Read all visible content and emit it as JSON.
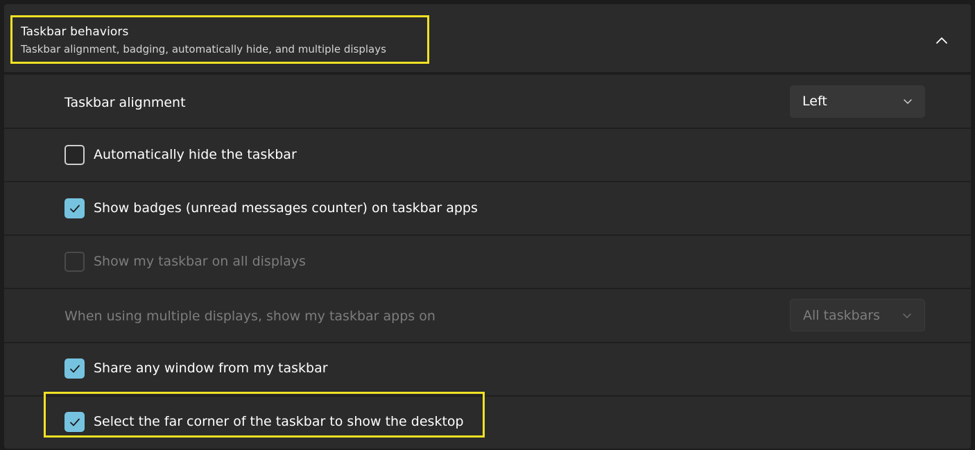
{
  "section": {
    "title": "Taskbar behaviors",
    "subtitle": "Taskbar alignment, badging, automatically hide, and multiple displays",
    "collapse_icon": "chevron-up-icon"
  },
  "settings": {
    "alignment": {
      "label": "Taskbar alignment",
      "value": "Left"
    },
    "auto_hide": {
      "label": "Automatically hide the taskbar",
      "checked": false
    },
    "badges": {
      "label": "Show badges (unread messages counter) on taskbar apps",
      "checked": true
    },
    "all_displays": {
      "label": "Show my taskbar on all displays",
      "checked": false,
      "disabled": true
    },
    "multi_display_apps": {
      "label": "When using multiple displays, show my taskbar apps on",
      "value": "All taskbars",
      "disabled": true
    },
    "share_window": {
      "label": "Share any window from my taskbar",
      "checked": true
    },
    "far_corner": {
      "label": "Select the far corner of the taskbar to show the desktop",
      "checked": true
    }
  },
  "colors": {
    "accent": "#76c3e0",
    "highlight": "#f0e224",
    "row_background": "#2b2b2b",
    "page_background": "#1c1c1c"
  }
}
